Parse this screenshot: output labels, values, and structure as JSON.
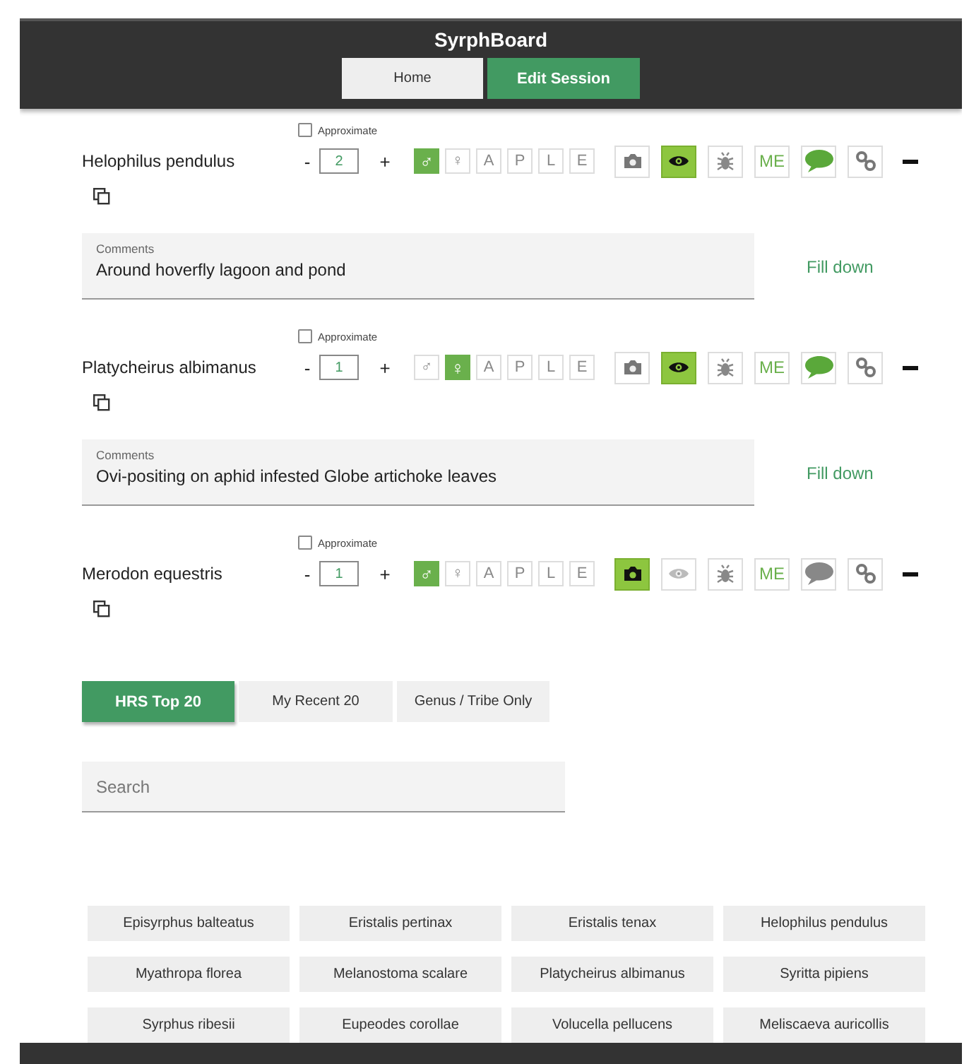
{
  "header": {
    "title": "SyrphBoard",
    "nav": [
      {
        "label": "Home",
        "selected": false
      },
      {
        "label": "Edit Session",
        "selected": true
      }
    ]
  },
  "records": [
    {
      "species": "Helophilus pendulus",
      "approximate": {
        "label": "Approximate",
        "checked": false
      },
      "decrement": "-",
      "count": "2",
      "increment": "+",
      "stages": [
        {
          "label": "♂",
          "selected": true
        },
        {
          "label": "♀",
          "selected": false
        },
        {
          "label": "A",
          "selected": false
        },
        {
          "label": "P",
          "selected": false
        },
        {
          "label": "L",
          "selected": false
        },
        {
          "label": "E",
          "selected": false
        }
      ],
      "toggles": [
        {
          "kind": "camera",
          "on": false
        },
        {
          "kind": "eye",
          "on": true
        },
        {
          "kind": "bug",
          "on": false
        },
        {
          "kind": "text",
          "label": "ME",
          "on": false
        },
        {
          "kind": "comment",
          "on": true
        },
        {
          "kind": "link",
          "on": false
        }
      ],
      "comments": {
        "label": "Comments",
        "value": "Around hoverfly lagoon and pond"
      },
      "fill_down": "Fill down"
    },
    {
      "species": "Platycheirus albimanus",
      "approximate": {
        "label": "Approximate",
        "checked": false
      },
      "decrement": "-",
      "count": "1",
      "increment": "+",
      "stages": [
        {
          "label": "♂",
          "selected": false
        },
        {
          "label": "♀",
          "selected": true
        },
        {
          "label": "A",
          "selected": false
        },
        {
          "label": "P",
          "selected": false
        },
        {
          "label": "L",
          "selected": false
        },
        {
          "label": "E",
          "selected": false
        }
      ],
      "toggles": [
        {
          "kind": "camera",
          "on": false
        },
        {
          "kind": "eye",
          "on": true
        },
        {
          "kind": "bug",
          "on": false
        },
        {
          "kind": "text",
          "label": "ME",
          "on": false
        },
        {
          "kind": "comment",
          "on": true
        },
        {
          "kind": "link",
          "on": false
        }
      ],
      "comments": {
        "label": "Comments",
        "value": "Ovi-positing on aphid infested Globe artichoke leaves"
      },
      "fill_down": "Fill down"
    },
    {
      "species": "Merodon equestris",
      "approximate": {
        "label": "Approximate",
        "checked": false
      },
      "decrement": "-",
      "count": "1",
      "increment": "+",
      "stages": [
        {
          "label": "♂",
          "selected": true
        },
        {
          "label": "♀",
          "selected": false
        },
        {
          "label": "A",
          "selected": false
        },
        {
          "label": "P",
          "selected": false
        },
        {
          "label": "L",
          "selected": false
        },
        {
          "label": "E",
          "selected": false
        }
      ],
      "toggles": [
        {
          "kind": "camera",
          "on": true
        },
        {
          "kind": "eye",
          "on": false
        },
        {
          "kind": "bug",
          "on": false
        },
        {
          "kind": "text",
          "label": "ME",
          "on": false
        },
        {
          "kind": "comment",
          "on": false
        },
        {
          "kind": "link",
          "on": false
        }
      ]
    }
  ],
  "list_tabs": [
    {
      "label": "HRS Top 20",
      "selected": true
    },
    {
      "label": "My Recent 20",
      "selected": false
    },
    {
      "label": "Genus / Tribe Only",
      "selected": false
    }
  ],
  "search": {
    "placeholder": "Search"
  },
  "species_buttons": [
    "Episyrphus balteatus",
    "Eristalis pertinax",
    "Eristalis tenax",
    "Helophilus pendulus",
    "Myathropa florea",
    "Melanostoma scalare",
    "Platycheirus albimanus",
    "Syritta pipiens",
    "Syrphus ribesii",
    "Eupeodes corollae",
    "Volucella pellucens",
    "Meliscaeva auricollis"
  ]
}
